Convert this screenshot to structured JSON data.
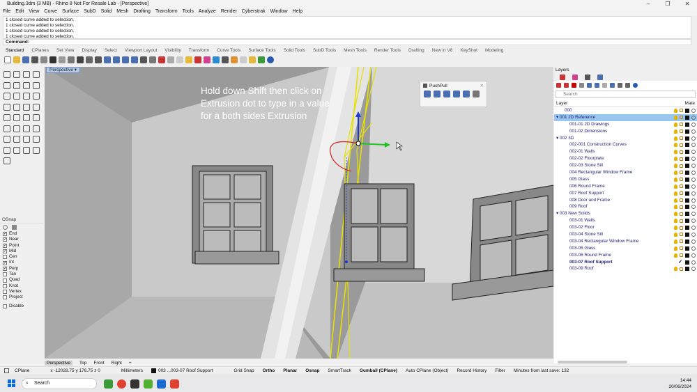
{
  "app": {
    "title": "Building.3dm (3 MB) - Rhino 8 Not For Resale Lab - [Perspective]"
  },
  "menu": [
    "File",
    "Edit",
    "View",
    "Curve",
    "Surface",
    "SubD",
    "Solid",
    "Mesh",
    "Drafting",
    "Transform",
    "Tools",
    "Analyze",
    "Render",
    "Cyberstrak",
    "Window",
    "Help"
  ],
  "command_history": [
    "1 closed curve added to selection.",
    "1 closed curve added to selection.",
    "1 closed curve added to selection.",
    "1 closed curve added to selection."
  ],
  "command_prompt": {
    "label": "Command:",
    "value": ""
  },
  "toolbar_tabs": [
    "Standard",
    "CPlanes",
    "Set View",
    "Display",
    "Select",
    "Viewport Layout",
    "Visibility",
    "Transform",
    "Curve Tools",
    "Surface Tools",
    "Solid Tools",
    "SubD Tools",
    "Mesh Tools",
    "Render Tools",
    "Drafting",
    "New in V8",
    "KeyShot",
    "Modeling"
  ],
  "viewport": {
    "tab_label": "Perspective",
    "instruction": "Hold down Shift then click on Extrusion dot to type in a value for a both sides Extrusion",
    "pushpull_title": "PushPull"
  },
  "viewport_tabs": [
    "Perspective",
    "Top",
    "Front",
    "Right"
  ],
  "osnap": {
    "title": "OSnap",
    "items": [
      {
        "label": "End",
        "checked": true
      },
      {
        "label": "Near",
        "checked": true
      },
      {
        "label": "Point",
        "checked": true
      },
      {
        "label": "Mid",
        "checked": true
      },
      {
        "label": "Cen",
        "checked": false
      },
      {
        "label": "Int",
        "checked": true
      },
      {
        "label": "Perp",
        "checked": true
      },
      {
        "label": "Tan",
        "checked": false
      },
      {
        "label": "Quad",
        "checked": false
      },
      {
        "label": "Knot",
        "checked": false
      },
      {
        "label": "Vertex",
        "checked": false
      },
      {
        "label": "Project",
        "checked": false
      }
    ],
    "disable_label": "Disable"
  },
  "layers": {
    "panel_title": "Layers",
    "search_placeholder": "Search",
    "col_layer": "Layer",
    "col_material": "Mate",
    "rows": [
      {
        "name": "000",
        "indent": 1,
        "selected": false,
        "bold": false,
        "expander": "",
        "check": false
      },
      {
        "name": "001 2D Reference",
        "indent": 0,
        "selected": true,
        "bold": false,
        "expander": "▾",
        "check": false
      },
      {
        "name": "001-01 2D Drawings",
        "indent": 2,
        "selected": false,
        "bold": false,
        "expander": "",
        "check": false
      },
      {
        "name": "001-02 Dimensions",
        "indent": 2,
        "selected": false,
        "bold": false,
        "expander": "",
        "check": false
      },
      {
        "name": "002 3D",
        "indent": 0,
        "selected": false,
        "bold": false,
        "expander": "▾",
        "check": false
      },
      {
        "name": "002-001 Construction Curves",
        "indent": 2,
        "selected": false,
        "bold": false,
        "expander": "",
        "check": false
      },
      {
        "name": "002-01 Walls",
        "indent": 2,
        "selected": false,
        "bold": false,
        "expander": "",
        "check": false
      },
      {
        "name": "002-02 Floorplate",
        "indent": 2,
        "selected": false,
        "bold": false,
        "expander": "",
        "check": false
      },
      {
        "name": "002-03 Stone Sill",
        "indent": 2,
        "selected": false,
        "bold": false,
        "expander": "",
        "check": false
      },
      {
        "name": "004 Rectangular Window Frame",
        "indent": 2,
        "selected": false,
        "bold": false,
        "expander": "",
        "check": false
      },
      {
        "name": "005 Glass",
        "indent": 2,
        "selected": false,
        "bold": false,
        "expander": "",
        "check": false
      },
      {
        "name": "006 Round Frame",
        "indent": 2,
        "selected": false,
        "bold": false,
        "expander": "",
        "check": false
      },
      {
        "name": "007 Roof Support",
        "indent": 2,
        "selected": false,
        "bold": false,
        "expander": "",
        "check": false
      },
      {
        "name": "008 Door and Frame",
        "indent": 2,
        "selected": false,
        "bold": false,
        "expander": "",
        "check": false
      },
      {
        "name": "009 Roof",
        "indent": 2,
        "selected": false,
        "bold": false,
        "expander": "",
        "check": false
      },
      {
        "name": "003 New Solids",
        "indent": 0,
        "selected": false,
        "bold": false,
        "expander": "▾",
        "check": false
      },
      {
        "name": "003-01 Walls",
        "indent": 2,
        "selected": false,
        "bold": false,
        "expander": "",
        "check": false
      },
      {
        "name": "003-02 Floor",
        "indent": 2,
        "selected": false,
        "bold": false,
        "expander": "",
        "check": false
      },
      {
        "name": "003-04 Stone Sill",
        "indent": 2,
        "selected": false,
        "bold": false,
        "expander": "",
        "check": false
      },
      {
        "name": "003-04 Rectangular Window Frame",
        "indent": 2,
        "selected": false,
        "bold": false,
        "expander": "",
        "check": false
      },
      {
        "name": "003-05 Glass",
        "indent": 2,
        "selected": false,
        "bold": false,
        "expander": "",
        "check": false
      },
      {
        "name": "003-06 Round Frame",
        "indent": 2,
        "selected": false,
        "bold": false,
        "expander": "",
        "check": false
      },
      {
        "name": "003-07 Roof Support",
        "indent": 2,
        "selected": false,
        "bold": true,
        "expander": "",
        "check": true
      },
      {
        "name": "003-09 Roof",
        "indent": 2,
        "selected": false,
        "bold": false,
        "expander": "",
        "check": false
      }
    ]
  },
  "status": {
    "cplane": "CPlane",
    "coords": "x -12028.75  y 176.75  z 0",
    "units": "Millimeters",
    "layer": "003 ...003-07 Roof Support",
    "grid_snap": "Grid Snap",
    "ortho": "Ortho",
    "planar": "Planar",
    "osnap": "Osnap",
    "smarttrack": "SmartTrack",
    "gumball": "Gumball (CPlane)",
    "auto_cplane": "Auto CPlane (Object)",
    "record_history": "Record History",
    "filter": "Filter",
    "minutes": "Minutes from last save: 132"
  },
  "taskbar": {
    "search_placeholder": "Search",
    "time": "14:44",
    "date": "20/06/2024"
  },
  "colors": {
    "accent": "#0a6cd6",
    "selection": "#99c7f0",
    "highlight_curve": "#e8e000"
  }
}
